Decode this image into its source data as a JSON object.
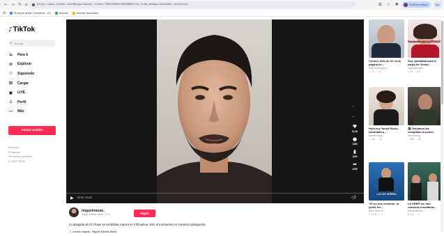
{
  "browser": {
    "url": "https://www.tiktok.com/@miguelmazac_/video/7384786651239988801?is_from_webapp=1&sender_device=pc",
    "bookmarks": [
      {
        "label": "Mi ayuda desde Chihuahua - GO",
        "color": "#4285f4"
      },
      {
        "label": "Noticias",
        "color": "#34a853"
      },
      {
        "label": "Noticias Nacionales",
        "color": "#fbbc05"
      }
    ],
    "profile_label": "Perfil de invitado",
    "update_label": "Act."
  },
  "sidebar": {
    "logo": "TikTok",
    "search_placeholder": "Buscar",
    "items": [
      {
        "label": "Para ti",
        "icon": "home-icon"
      },
      {
        "label": "Explorar",
        "icon": "compass-icon"
      },
      {
        "label": "Siguiendo",
        "icon": "following-icon"
      },
      {
        "label": "Cargar",
        "icon": "upload-icon"
      },
      {
        "label": "LIVE",
        "icon": "live-icon"
      },
      {
        "label": "Perfil",
        "icon": "profile-icon"
      },
      {
        "label": "Más",
        "icon": "more-icon"
      }
    ],
    "login_label": "Iniciar sesión",
    "footer": [
      "Empresa",
      "Programa",
      "Términos y políticas",
      "© 2024 TikTok"
    ]
  },
  "video": {
    "time": "00:02 / 01:30",
    "actions": [
      {
        "icon": "heart-icon",
        "count": "15,4K"
      },
      {
        "icon": "comment-icon",
        "count": "1366"
      },
      {
        "icon": "bookmark-icon",
        "count": "1409"
      },
      {
        "icon": "share-icon",
        "count": "1259"
      }
    ]
  },
  "author": {
    "username": "miguelmazac_",
    "subtitle": "Miguel Alfonso Maza · 6-24",
    "follow_label": "Seguir",
    "description": "La abogada de El Chapo se candidata a jueza en Chihuahua. Esto encontramos en nuestra investigación.",
    "music": "sonido original - Miguel Alfonso Maza"
  },
  "recommended": [
    {
      "title": "Conoce más de mí en la página de...",
      "user": "adrianmonteagudo",
      "stats": "▷ 7.9  ·  ♡ 6.7",
      "caption": "",
      "palette": "suit"
    },
    {
      "title": "Soy candidata para el cargo de Jueza...",
      "user": "angelagonzalez",
      "stats": "▷ 16  ·  ♡ 8.4",
      "caption": "Conóceme para la ATENCIÓN",
      "palette": "woman"
    },
    {
      "title": "Hola soy Yanelt Rocio, candidata a...",
      "user": "yaneltrocioguz",
      "stats": "▷ 143  ·  ♡ 28",
      "caption": "",
      "palette": "office"
    },
    {
      "title": "🎥 Sefuimos las campañas al poder...",
      "user": "elejerciciodg",
      "stats": "▷ 996  ·  ♡ 45",
      "caption": "",
      "palette": "man"
    },
    {
      "title": "\"Si no nos esmeran, la gente les...",
      "user": "radio_fomento",
      "stats": "▷ 4,0 M  ·  ♡ 1",
      "caption": "LOS DE ARRIBA",
      "palette": "court"
    },
    {
      "title": "La OEBR me dice nuestros resultados...",
      "user": "bibliotecamdsa",
      "stats": "▷ 511  ·  ♡ 1",
      "caption": "",
      "palette": "hall"
    }
  ]
}
